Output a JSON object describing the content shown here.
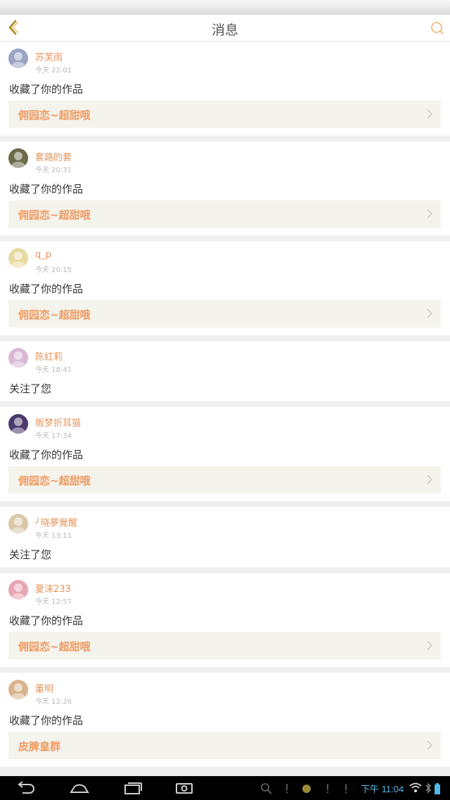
{
  "header": {
    "title": "消息"
  },
  "messages": [
    {
      "user": "苏芙雨",
      "time": "今天 22:01",
      "action": "收藏了你的作品",
      "work": "佣园恋~超甜哦",
      "avatar_color": "#9aa3c4"
    },
    {
      "user": "套路的套",
      "time": "今天 20:31",
      "action": "收藏了你的作品",
      "work": "佣园恋~超甜哦",
      "avatar_color": "#6b6b4a"
    },
    {
      "user": "q_p",
      "time": "今天 20:15",
      "action": "收藏了你的作品",
      "work": "佣园恋~超甜哦",
      "avatar_color": "#e8d9a0"
    },
    {
      "user": "陈红莉",
      "time": "今天 18:41",
      "action": "关注了您",
      "work": null,
      "avatar_color": "#d9b8d6"
    },
    {
      "user": "贩梦折耳猫",
      "time": "今天 17:34",
      "action": "收藏了你的作品",
      "work": "佣园恋~超甜哦",
      "avatar_color": "#4a3a6e"
    },
    {
      "user": "╯晓夢覺醒",
      "time": "今天 13:11",
      "action": "关注了您",
      "work": null,
      "avatar_color": "#d9c7a8"
    },
    {
      "user": "夏沫233",
      "time": "今天 12:57",
      "action": "收藏了你的作品",
      "work": "佣园恋~超甜哦",
      "avatar_color": "#e6a6b3"
    },
    {
      "user": "董明",
      "time": "今天 12:26",
      "action": "收藏了你的作品",
      "work": "皮脾皇群",
      "avatar_color": "#d8b48e"
    }
  ],
  "status_bar": {
    "time": "下午 11:04"
  },
  "colors": {
    "accent": "#ef9a62",
    "username": "#e8935a",
    "work_bg": "#f4f3ec",
    "clock": "#52b7ea"
  },
  "icons": {
    "back": "back-chevron-icon",
    "search": "search-icon",
    "work_arrow": "chevron-right-icon"
  }
}
